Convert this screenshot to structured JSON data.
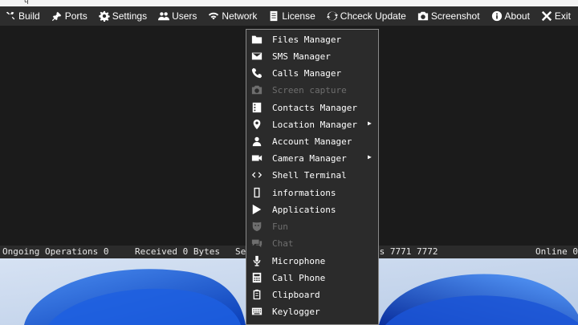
{
  "menubar": {
    "items": [
      {
        "label": "Build",
        "icon": "tools-icon"
      },
      {
        "label": "Ports",
        "icon": "plug-icon"
      },
      {
        "label": "Settings",
        "icon": "gear-icon"
      },
      {
        "label": "Users",
        "icon": "users-icon"
      },
      {
        "label": "Network",
        "icon": "wifi-icon"
      },
      {
        "label": "License",
        "icon": "document-icon"
      },
      {
        "label": "Chceck Update",
        "icon": "sync-icon"
      },
      {
        "label": "Screenshot",
        "icon": "camera-icon"
      },
      {
        "label": "About",
        "icon": "info-icon"
      },
      {
        "label": "Exit",
        "icon": "close-icon"
      }
    ]
  },
  "statusbar": {
    "operations": "Ongoing Operations 0",
    "received": "Received 0 Bytes",
    "sent_fragment": "Se",
    "ports_fragment": "ts 7771 7772",
    "online": "Online 0"
  },
  "context_menu": {
    "items": [
      {
        "label": "Files Manager",
        "icon": "folder-icon",
        "enabled": true
      },
      {
        "label": "SMS Manager",
        "icon": "envelope-icon",
        "enabled": true
      },
      {
        "label": "Calls Manager",
        "icon": "phone-icon",
        "enabled": true
      },
      {
        "label": "Screen capture",
        "icon": "camera-icon",
        "enabled": false
      },
      {
        "label": "Contacts Manager",
        "icon": "contacts-icon",
        "enabled": true
      },
      {
        "label": "Location Manager",
        "icon": "location-pin-icon",
        "enabled": true,
        "submenu": true
      },
      {
        "label": "Account Manager",
        "icon": "person-icon",
        "enabled": true
      },
      {
        "label": "Camera Manager",
        "icon": "video-camera-icon",
        "enabled": true,
        "submenu": true
      },
      {
        "label": "Shell Terminal",
        "icon": "code-icon",
        "enabled": true
      },
      {
        "label": "informations",
        "icon": "device-icon",
        "enabled": true
      },
      {
        "label": "Applications",
        "icon": "play-store-icon",
        "enabled": true
      },
      {
        "label": "Fun",
        "icon": "mask-icon",
        "enabled": false
      },
      {
        "label": "Chat",
        "icon": "chat-icon",
        "enabled": false
      },
      {
        "label": "Microphone",
        "icon": "microphone-icon",
        "enabled": true
      },
      {
        "label": "Call Phone",
        "icon": "dialpad-icon",
        "enabled": true
      },
      {
        "label": "Clipboard",
        "icon": "clipboard-icon",
        "enabled": true
      },
      {
        "label": "Keylogger",
        "icon": "keyboard-icon",
        "enabled": true
      }
    ]
  }
}
